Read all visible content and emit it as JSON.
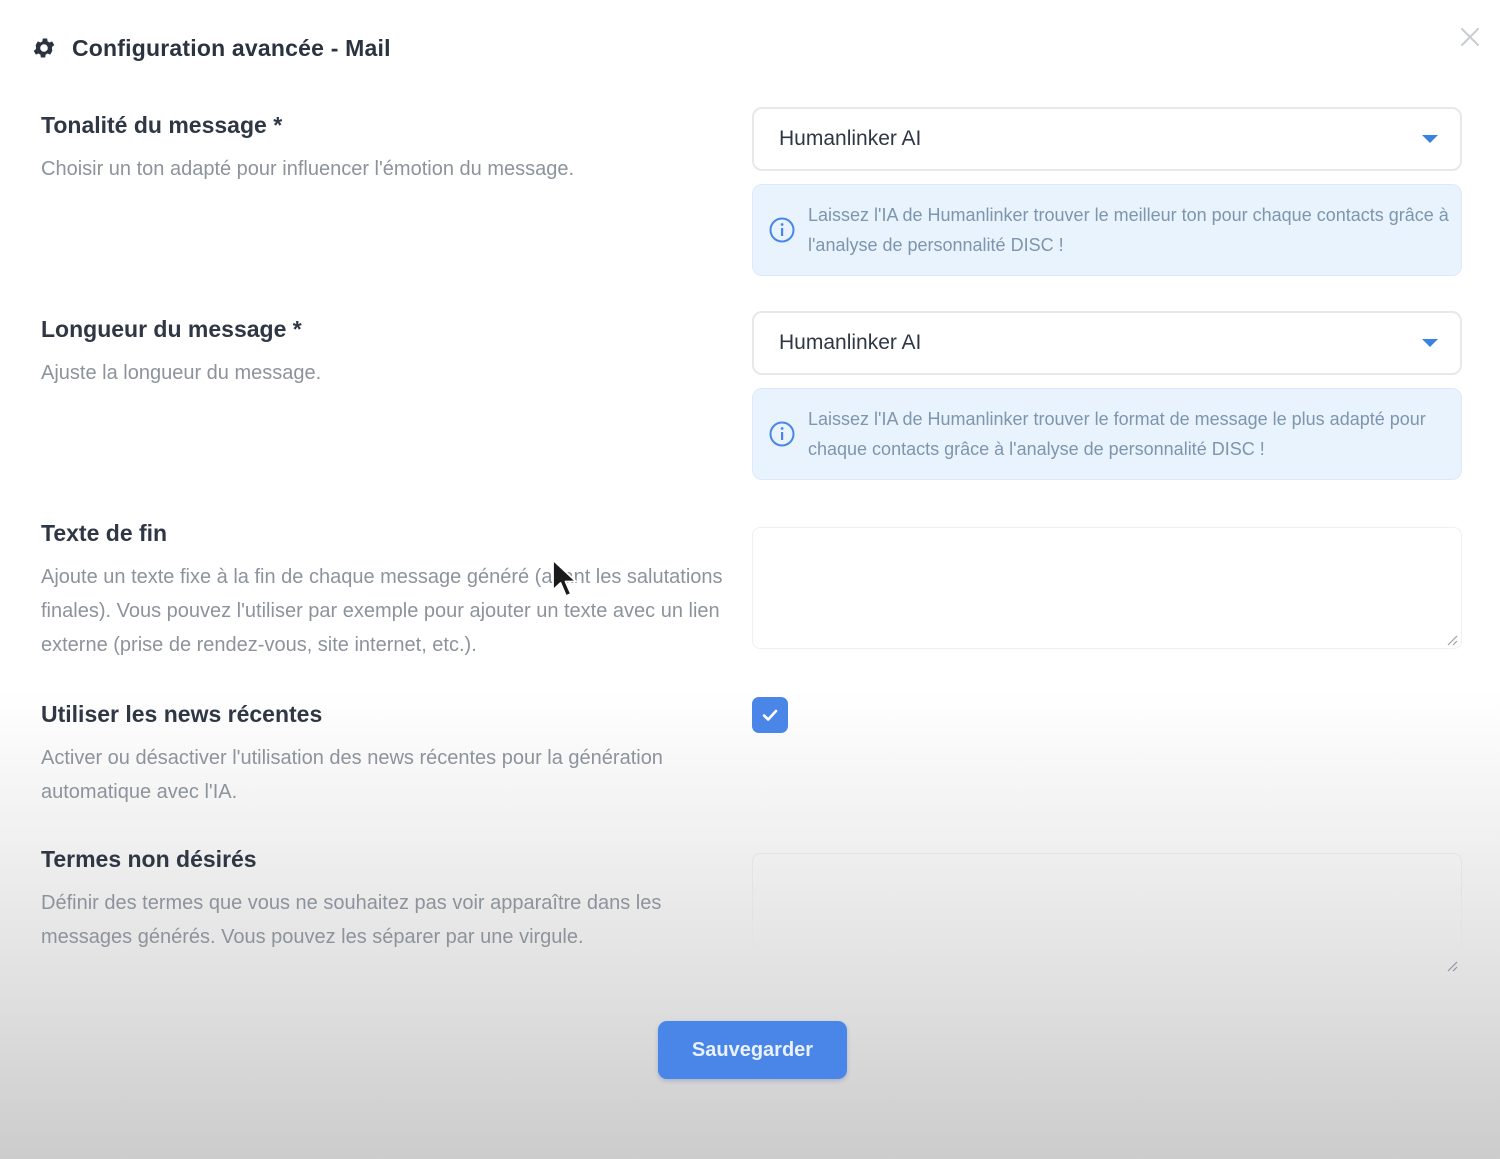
{
  "dialog": {
    "title": "Configuration avancée - Mail",
    "icon": "gear-icon",
    "close_icon": "close-icon"
  },
  "fields": {
    "tone": {
      "label": "Tonalité du message *",
      "description": "Choisir un ton adapté pour influencer l'émotion du message.",
      "selected": "Humanlinker AI",
      "info": "Laissez l'IA de Humanlinker trouver le meilleur ton pour chaque contacts grâce à l'analyse de personnalité DISC !"
    },
    "length": {
      "label": "Longueur du message *",
      "description": "Ajuste la longueur du message.",
      "selected": "Humanlinker AI",
      "info": "Laissez l'IA de Humanlinker trouver le format de message le plus adapté pour chaque contacts grâce à l'analyse de personnalité DISC !"
    },
    "end_text": {
      "label": "Texte de fin",
      "description": "Ajoute un texte fixe à la fin de chaque message généré (avant les salutations finales). Vous pouvez l'utiliser par exemple pour ajouter un texte avec un lien externe (prise de rendez-vous, site internet, etc.).",
      "value": ""
    },
    "recent_news": {
      "label": "Utiliser les news récentes",
      "description": "Activer ou désactiver l'utilisation des news récentes pour la génération automatique avec l'IA.",
      "checked": true
    },
    "unwanted_terms": {
      "label": "Termes non désirés",
      "description": "Définir des termes que vous ne souhaitez pas voir apparaître dans les messages générés. Vous pouvez les séparer par une virgule.",
      "value": ""
    }
  },
  "actions": {
    "save_label": "Sauvegarder"
  },
  "colors": {
    "accent": "#4a86e8",
    "info_bg": "#e8f3fd",
    "info_text": "#7e95ad",
    "label": "#2f3744",
    "description": "#8d939c"
  }
}
